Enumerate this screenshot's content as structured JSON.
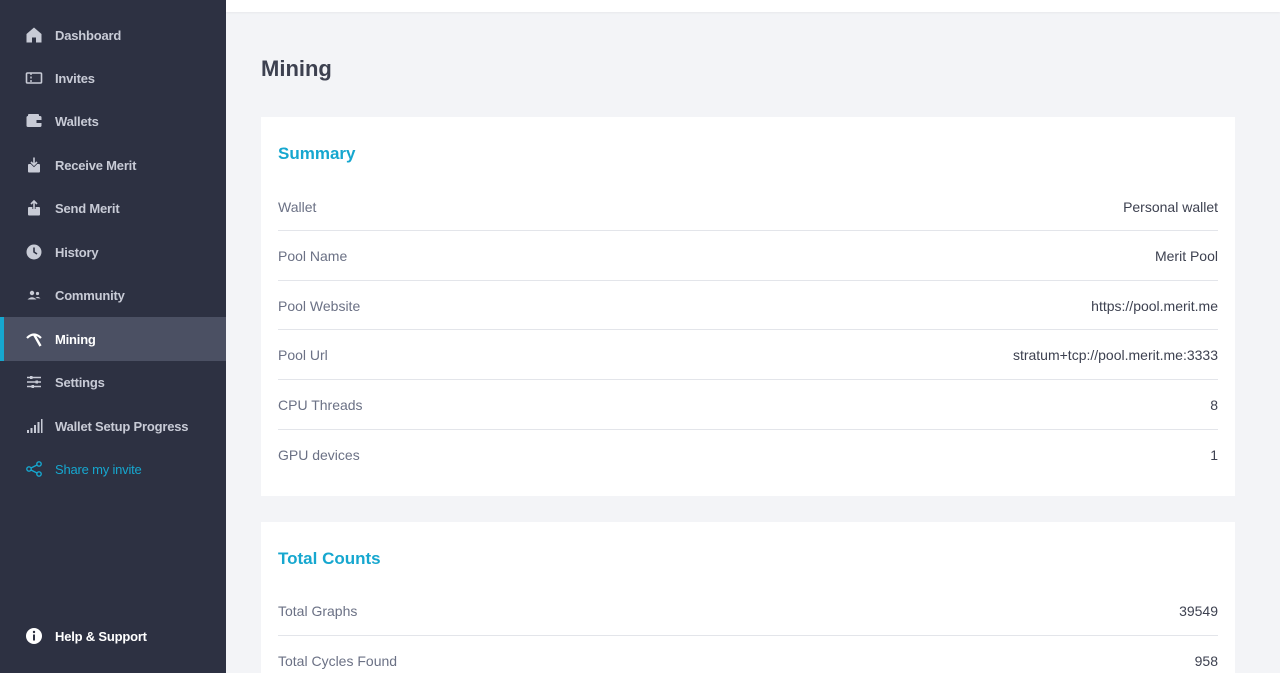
{
  "sidebar": {
    "items": [
      {
        "label": "Dashboard",
        "icon": "home-icon"
      },
      {
        "label": "Invites",
        "icon": "ticket-icon"
      },
      {
        "label": "Wallets",
        "icon": "wallet-icon"
      },
      {
        "label": "Receive Merit",
        "icon": "receive-icon"
      },
      {
        "label": "Send Merit",
        "icon": "send-icon"
      },
      {
        "label": "History",
        "icon": "clock-icon"
      },
      {
        "label": "Community",
        "icon": "community-icon"
      },
      {
        "label": "Mining",
        "icon": "pickaxe-icon",
        "active": true
      },
      {
        "label": "Settings",
        "icon": "sliders-icon"
      },
      {
        "label": "Wallet Setup Progress",
        "icon": "signal-bars-icon"
      },
      {
        "label": "Share my invite",
        "icon": "share-icon"
      }
    ],
    "help": {
      "label": "Help & Support",
      "icon": "info-icon"
    }
  },
  "page": {
    "title": "Mining"
  },
  "summary": {
    "title": "Summary",
    "rows": [
      {
        "key": "Wallet",
        "value": "Personal wallet"
      },
      {
        "key": "Pool Name",
        "value": "Merit Pool"
      },
      {
        "key": "Pool Website",
        "value": "https://pool.merit.me"
      },
      {
        "key": "Pool Url",
        "value": "stratum+tcp://pool.merit.me:3333"
      },
      {
        "key": "CPU Threads",
        "value": "8"
      },
      {
        "key": "GPU devices",
        "value": "1"
      }
    ]
  },
  "totals": {
    "title": "Total Counts",
    "rows": [
      {
        "key": "Total Graphs",
        "value": "39549"
      },
      {
        "key": "Total Cycles Found",
        "value": "958"
      }
    ]
  },
  "colors": {
    "sidebar_bg": "#2d3142",
    "accent": "#16a7cf",
    "active_bg": "#4b5063",
    "page_bg": "#f3f4f7"
  }
}
